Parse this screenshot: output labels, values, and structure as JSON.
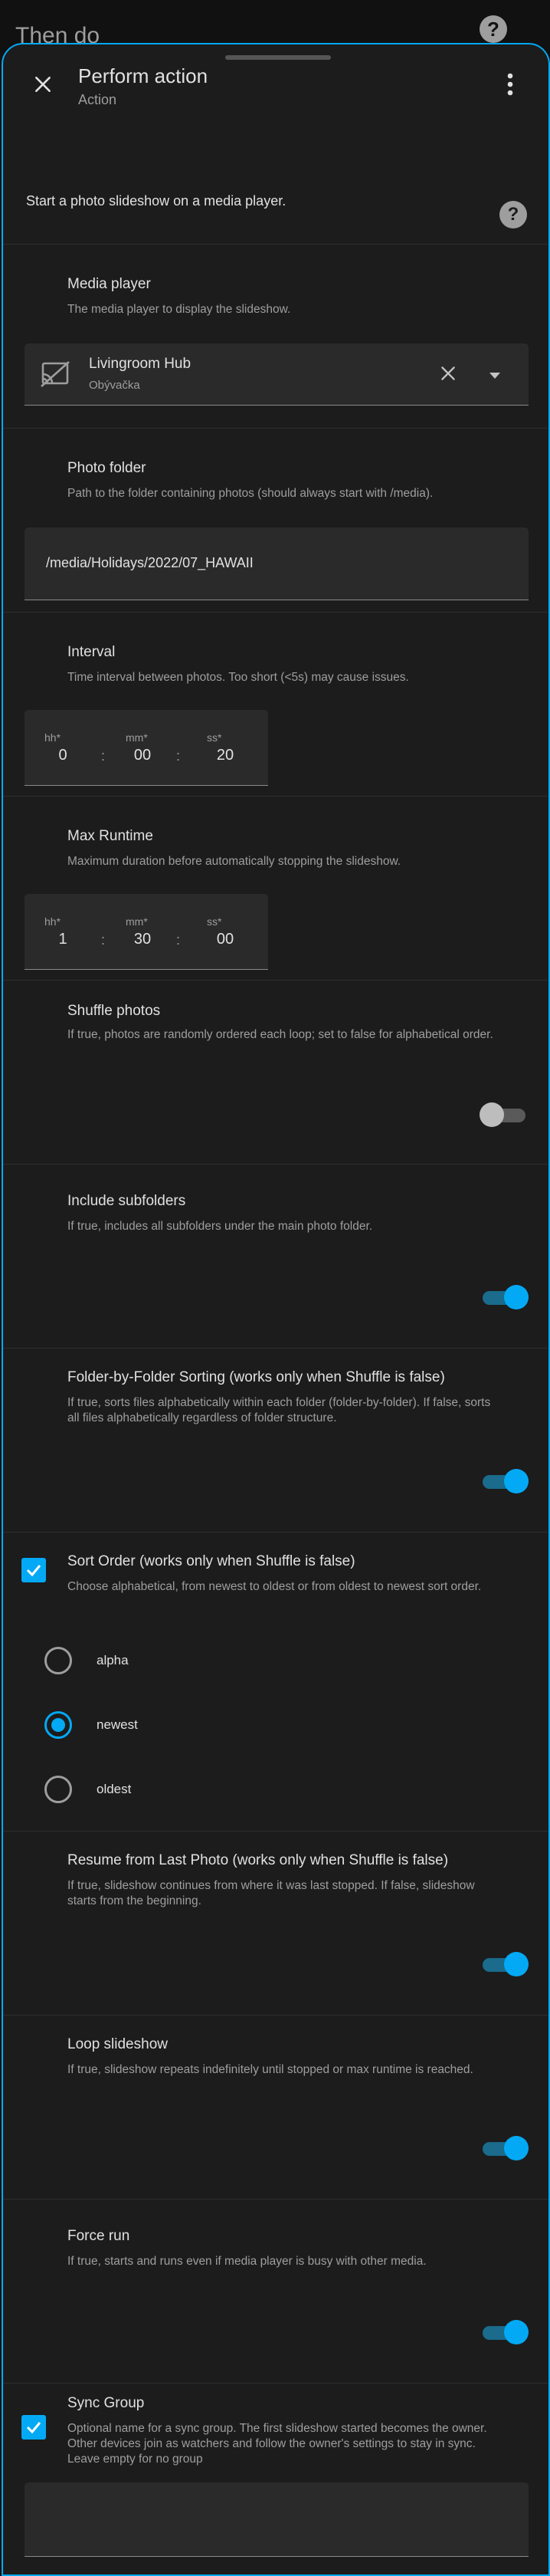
{
  "background": {
    "title": "Then do",
    "help_icon": "help-circle-icon"
  },
  "dialog": {
    "title": "Perform action",
    "subtitle": "Action",
    "intro": "Start a photo slideshow on a media player.",
    "icons": {
      "close": "close-icon",
      "more": "dots-vertical-icon",
      "help": "help-circle-icon"
    }
  },
  "media_player": {
    "title": "Media player",
    "description": "The media player to display the slideshow.",
    "selected_name": "Livingroom Hub",
    "selected_area": "Obývačka",
    "icon": "cast-off-icon"
  },
  "photo_folder": {
    "title": "Photo folder",
    "description": "Path to the folder containing photos (should always start with /media).",
    "value": "/media/Holidays/2022/07_HAWAII"
  },
  "interval": {
    "title": "Interval",
    "description": "Time interval between photos. Too short (<5s) may cause issues.",
    "hh_label": "hh*",
    "mm_label": "mm*",
    "ss_label": "ss*",
    "hh": "0",
    "mm": "00",
    "ss": "20",
    "separator": ":"
  },
  "max_runtime": {
    "title": "Max Runtime",
    "description": "Maximum duration before automatically stopping the slideshow.",
    "hh_label": "hh*",
    "mm_label": "mm*",
    "ss_label": "ss*",
    "hh": "1",
    "mm": "30",
    "ss": "00",
    "separator": ":"
  },
  "shuffle": {
    "title": "Shuffle photos",
    "description": "If true, photos are randomly ordered each loop; set to false for alphabetical order.",
    "enabled": false
  },
  "subfolders": {
    "title": "Include subfolders",
    "description": "If true, includes all subfolders under the main photo folder.",
    "enabled": true
  },
  "folder_sorting": {
    "title": "Folder-by-Folder Sorting (works only when Shuffle is false)",
    "description": "If true, sorts files alphabetically within each folder (folder-by-folder). If false, sorts all files alphabetically regardless of folder structure.",
    "enabled": true
  },
  "sort_order": {
    "title": "Sort Order (works only when Shuffle is false)",
    "description": "Choose alphabetical, from newest to oldest or from oldest to newest sort order.",
    "checked": true,
    "options": [
      "alpha",
      "newest",
      "oldest"
    ],
    "selected": "newest"
  },
  "resume": {
    "title": "Resume from Last Photo (works only when Shuffle is false)",
    "description": "If true, slideshow continues from where it was last stopped. If false, slideshow starts from the beginning.",
    "enabled": true
  },
  "loop": {
    "title": "Loop slideshow",
    "description": "If true, slideshow repeats indefinitely until stopped or max runtime is reached.",
    "enabled": true
  },
  "force_run": {
    "title": "Force run",
    "description": "If true, starts and runs even if media player is busy with other media.",
    "enabled": true
  },
  "sync_group": {
    "title": "Sync Group",
    "description": "Optional name for a sync group. The first slideshow started becomes the owner. Other devices join as watchers and follow the owner's settings to stay in sync. Leave empty for no group",
    "checked": true,
    "value": ""
  },
  "colors": {
    "accent": "#03a9f4",
    "surface": "#1c1c1c",
    "field": "#2a2a2a",
    "secondary_text": "#9e9e9e"
  }
}
